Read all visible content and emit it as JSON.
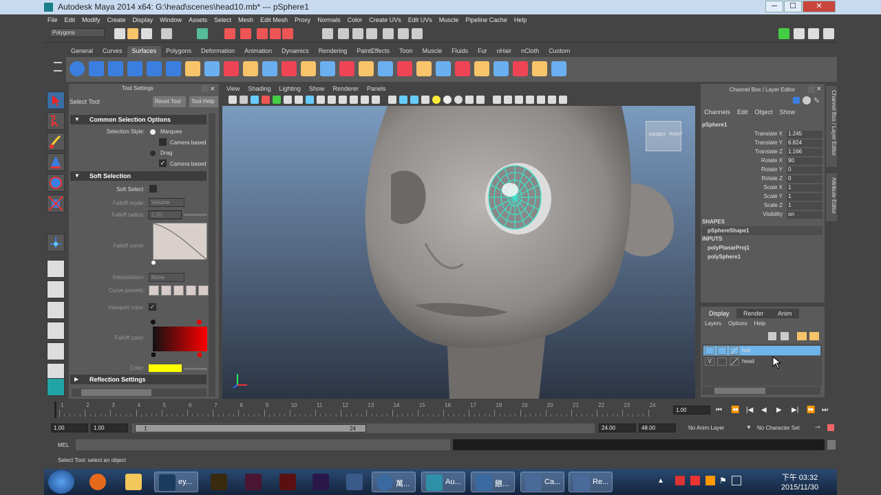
{
  "window": {
    "title": "Autodesk Maya 2014 x64: G:\\head\\scenes\\head10.mb*  ---  pSphere1",
    "min_label": "─",
    "max_label": "☐",
    "close_label": "✕"
  },
  "menubar": [
    "File",
    "Edit",
    "Modify",
    "Create",
    "Display",
    "Window",
    "Assets",
    "Select",
    "Mesh",
    "Edit Mesh",
    "Proxy",
    "Normals",
    "Color",
    "Create UVs",
    "Edit UVs",
    "Muscle",
    "Pipeline Cache",
    "Help"
  ],
  "statusline": {
    "menu_set": "Polygons"
  },
  "shelf": {
    "tabs": [
      "General",
      "Curves",
      "Surfaces",
      "Polygons",
      "Deformation",
      "Animation",
      "Dynamics",
      "Rendering",
      "PaintEffects",
      "Toon",
      "Muscle",
      "Fluids",
      "Fur",
      "nHair",
      "nCloth",
      "Custom"
    ],
    "active_tab": "Surfaces"
  },
  "tool_settings": {
    "panel_title": "Tool Settings",
    "tool_name": "Select Tool",
    "reset_label": "Reset Tool",
    "help_label": "Tool Help",
    "common_header": "Common Selection Options",
    "selection_style_label": "Selection Style:",
    "marquee_label": "Marquee",
    "camera_based_1": "Camera based",
    "drag_label": "Drag",
    "camera_based_2": "Camera based",
    "soft_header": "Soft Selection",
    "soft_select_label": "Soft Select:",
    "falloff_mode_label": "Falloff mode:",
    "falloff_mode_value": "Volume",
    "falloff_radius_label": "Falloff radius:",
    "falloff_radius_value": "1.00",
    "falloff_curve_label": "Falloff curve:",
    "interpolation_label": "Interpolation:",
    "interpolation_value": "None",
    "curve_presets_label": "Curve presets:",
    "viewport_color_label": "Viewport color:",
    "falloff_color_label": "Falloff color:",
    "color_label": "Color:",
    "reflection_header": "Reflection Settings"
  },
  "viewport": {
    "menu": [
      "View",
      "Shading",
      "Lighting",
      "Show",
      "Renderer",
      "Panels"
    ],
    "cube_front": "FRONT",
    "cube_right": "RIGHT"
  },
  "channel_box": {
    "panel_title": "Channel Box / Layer Editor",
    "menu": [
      "Channels",
      "Edit",
      "Object",
      "Show"
    ],
    "object": "pSphere1",
    "channels": [
      {
        "name": "Translate X",
        "value": "1.245"
      },
      {
        "name": "Translate Y",
        "value": "6.824"
      },
      {
        "name": "Translate Z",
        "value": "1.166"
      },
      {
        "name": "Rotate X",
        "value": "90"
      },
      {
        "name": "Rotate Y",
        "value": "0"
      },
      {
        "name": "Rotate Z",
        "value": "0"
      },
      {
        "name": "Scale X",
        "value": "1"
      },
      {
        "name": "Scale Y",
        "value": "1"
      },
      {
        "name": "Scale Z",
        "value": "1"
      },
      {
        "name": "Visibility",
        "value": "on"
      }
    ],
    "shapes_header": "SHAPES",
    "shape": "pSphereShape1",
    "inputs_header": "INPUTS",
    "inputs": [
      "polyPlanarProj1",
      "polySphere1"
    ],
    "side_tab_1": "Channel Box / Layer Editor",
    "side_tab_2": "Attribute Editor"
  },
  "layer_editor": {
    "tabs": [
      "Display",
      "Render",
      "Anim"
    ],
    "menu": [
      "Layers",
      "Options",
      "Help"
    ],
    "layers": [
      {
        "name": "hair",
        "visible": "",
        "selected": true
      },
      {
        "name": "head",
        "visible": "V",
        "selected": false
      }
    ]
  },
  "timeline": {
    "ticks": [
      "1",
      "2",
      "3",
      "4",
      "5",
      "6",
      "7",
      "8",
      "9",
      "10",
      "11",
      "12",
      "13",
      "14",
      "15",
      "16",
      "17",
      "18",
      "19",
      "20",
      "21",
      "22",
      "23",
      "24"
    ],
    "current": "1.00",
    "range_start": "1.00",
    "range_start2": "1.00",
    "range_inner_start": "1",
    "range_inner_end": "24",
    "range_end": "24.00",
    "range_end2": "48.00",
    "anim_layer": "No Anim Layer",
    "char_set": "No Character Set"
  },
  "command": {
    "mel_label": "MEL",
    "help": "Select Tool: select an object"
  },
  "taskbar": {
    "items": [
      "ey...",
      "萬...",
      "Au...",
      "餵...",
      "Ca...",
      "Re..."
    ],
    "time": "下午 03:32",
    "date": "2015/11/30"
  },
  "colors": {
    "accent": "#3fe0c8",
    "selection": "#6fb4e8",
    "falloff_red": "#ff0000",
    "color_swatch": "#ffff00"
  }
}
